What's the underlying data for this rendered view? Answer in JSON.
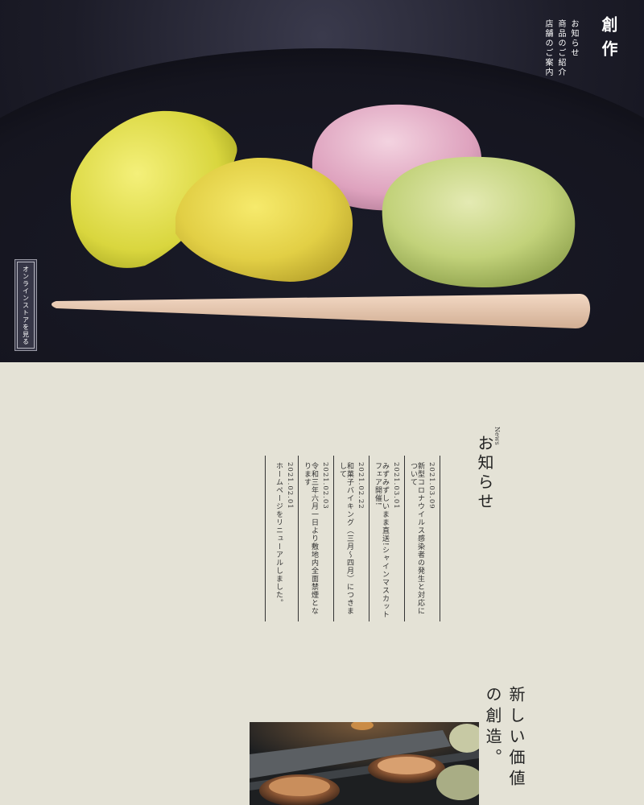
{
  "header": {
    "brand": "創作",
    "nav": [
      "お知らせ",
      "商品のご紹介",
      "店舗のご案内"
    ]
  },
  "hero": {
    "store_button": "オンラインストアを見る"
  },
  "news": {
    "label": "News",
    "title": "お知らせ",
    "items": [
      {
        "date": "2021.03.09",
        "headline": "新型コロナウイルス感染者の発生と対応について"
      },
      {
        "date": "2021.03.01",
        "headline": "みずみずしいまま直送!シャインマスカットフェア開催!"
      },
      {
        "date": "2021.02.22",
        "headline": "和菓子バイキング（三月〜四月）につきまして"
      },
      {
        "date": "2021.02.03",
        "headline": "令和三年六月一日より敷地内全面禁煙となります"
      },
      {
        "date": "2021.02.01",
        "headline": "ホームページをリニューアルしました。"
      }
    ]
  },
  "value": {
    "title": "新しい価値の創造。"
  }
}
